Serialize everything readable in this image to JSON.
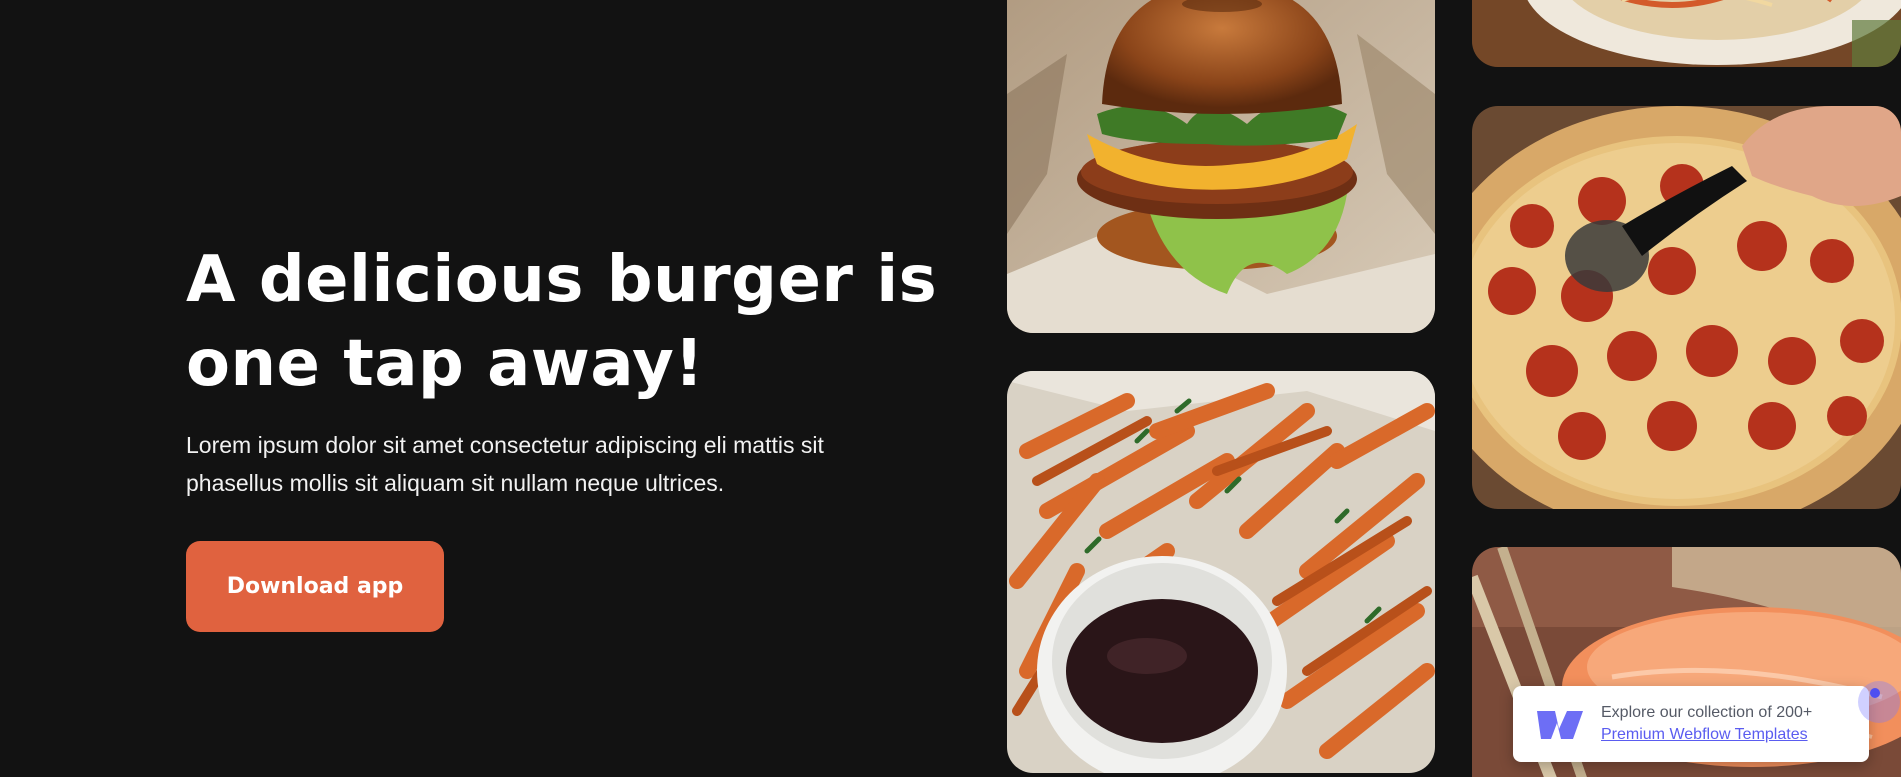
{
  "hero": {
    "title_line1": "A delicious burger is",
    "title_line2": "one tap away!",
    "paragraph_line1": "Lorem ipsum dolor sit amet consectetur adipiscing eli mattis sit",
    "paragraph_line2": "phasellus mollis sit aliquam sit nullam neque ultrices.",
    "button_label": "Download app"
  },
  "images": [
    {
      "name": "burger-photo",
      "subject": "burger"
    },
    {
      "name": "fries-photo",
      "subject": "sweet potato fries with dip"
    },
    {
      "name": "noodles-photo",
      "subject": "noodle bowl"
    },
    {
      "name": "pizza-photo",
      "subject": "pepperoni pizza"
    },
    {
      "name": "sushi-photo",
      "subject": "salmon sushi"
    }
  ],
  "promo": {
    "line1": "Explore our collection of 200+",
    "link": "Premium Webflow Templates"
  },
  "colors": {
    "background": "#121212",
    "accent": "#e0623f",
    "link": "#5a5cf0"
  }
}
